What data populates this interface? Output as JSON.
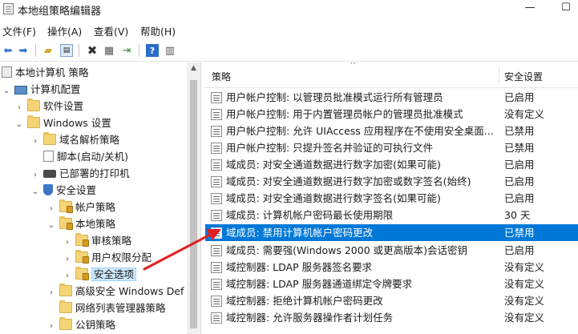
{
  "window": {
    "title": "本地组策略编辑器",
    "minimize_glyph": "—",
    "maximize_glyph": "☐"
  },
  "menu": [
    "文件(F)",
    "操作(A)",
    "查看(V)",
    "帮助(H)"
  ],
  "toolbar": {
    "icons": [
      "back-icon",
      "forward-icon",
      "up-folder-icon",
      "show-hide-tree-icon",
      "delete-icon",
      "properties-icon",
      "export-list-icon",
      "help-icon",
      "filter-icon"
    ]
  },
  "tree": {
    "items": [
      {
        "label": "本地计算机 策略",
        "icon": "policy"
      },
      {
        "label": "计算机配置",
        "icon": "computer"
      },
      {
        "label": "软件设置",
        "icon": "folder"
      },
      {
        "label": "Windows 设置",
        "icon": "folder"
      },
      {
        "label": "域名解析策略",
        "icon": "folder"
      },
      {
        "label": "脚本(启动/关机)",
        "icon": "document"
      },
      {
        "label": "已部署的打印机",
        "icon": "printer"
      },
      {
        "label": "安全设置",
        "icon": "shield"
      },
      {
        "label": "帐户策略",
        "icon": "folder-lock"
      },
      {
        "label": "本地策略",
        "icon": "folder-lock"
      },
      {
        "label": "审核策略",
        "icon": "folder-lock"
      },
      {
        "label": "用户权限分配",
        "icon": "folder-lock"
      },
      {
        "label": "安全选项",
        "icon": "folder-lock"
      },
      {
        "label": "高级安全 Windows Def",
        "icon": "folder"
      },
      {
        "label": "网络列表管理器策略",
        "icon": "folder"
      },
      {
        "label": "公钥策略",
        "icon": "folder"
      }
    ]
  },
  "list": {
    "col_policy": "策略",
    "col_setting": "安全设置",
    "rows": [
      {
        "name": "用户帐户控制: 以管理员批准模式运行所有管理员",
        "value": "已启用"
      },
      {
        "name": "用户帐户控制: 用于内置管理员帐户的管理员批准模式",
        "value": "没有定义"
      },
      {
        "name": "用户帐户控制: 允许 UIAccess 应用程序在不使用安全桌面...",
        "value": "已禁用"
      },
      {
        "name": "用户帐户控制: 只提升签名并验证的可执行文件",
        "value": "已禁用"
      },
      {
        "name": "域成员: 对安全通道数据进行数字加密(如果可能)",
        "value": "已启用"
      },
      {
        "name": "域成员: 对安全通道数据进行数字加密或数字签名(始终)",
        "value": "已启用"
      },
      {
        "name": "域成员: 对安全通道数据进行数字签名(如果可能)",
        "value": "已启用"
      },
      {
        "name": "域成员: 计算机帐户密码最长使用期限",
        "value": "30 天"
      },
      {
        "name": "域成员: 禁用计算机帐户密码更改",
        "value": "已禁用"
      },
      {
        "name": "域成员: 需要强(Windows 2000 或更高版本)会话密钥",
        "value": "已启用"
      },
      {
        "name": "域控制器: LDAP 服务器签名要求",
        "value": "没有定义"
      },
      {
        "name": "域控制器: LDAP 服务器通道绑定令牌要求",
        "value": "没有定义"
      },
      {
        "name": "域控制器: 拒绝计算机帐户密码更改",
        "value": "没有定义"
      },
      {
        "name": "域控制器: 允许服务器操作者计划任务",
        "value": "没有定义"
      }
    ]
  },
  "colors": {
    "selection": "#0078d7",
    "tree_selection": "#cce8ff",
    "annotation_arrow": "#e02020"
  }
}
